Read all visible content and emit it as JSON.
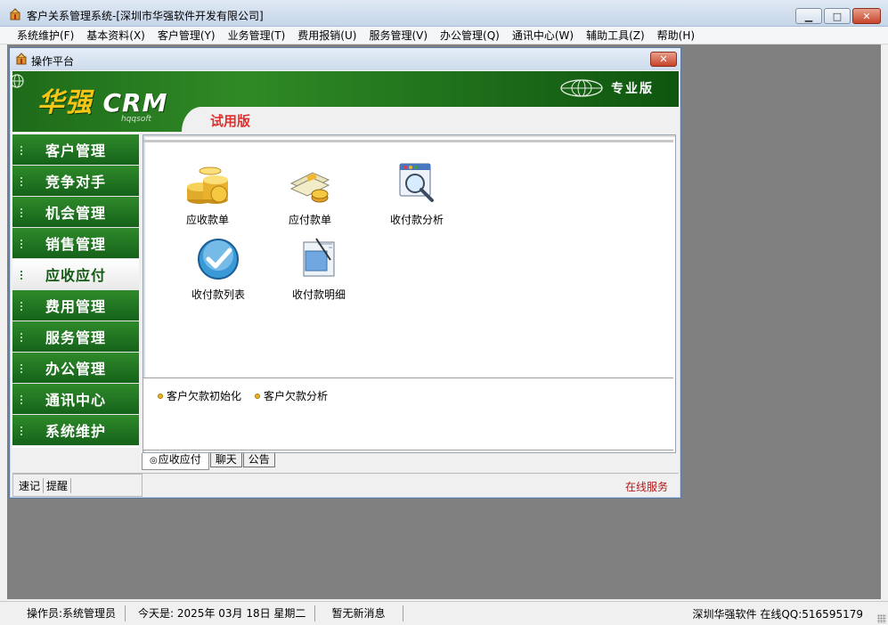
{
  "window": {
    "title": "客户关系管理系统-[深圳市华强软件开发有限公司]",
    "minimize_symbol": "▁",
    "maximize_symbol": "□",
    "close_symbol": "✕"
  },
  "menubar": {
    "items": [
      "系统维护(F)",
      "基本资料(X)",
      "客户管理(Y)",
      "业务管理(T)",
      "费用报销(U)",
      "服务管理(V)",
      "办公管理(Q)",
      "通讯中心(W)",
      "辅助工具(Z)",
      "帮助(H)"
    ]
  },
  "child_window": {
    "title": "操作平台",
    "close_symbol": "✕"
  },
  "banner": {
    "logo_cn": "华强",
    "logo_en": "CRM",
    "logo_sub": "hqqsoft",
    "edition": "专业版",
    "trial": "试用版"
  },
  "nav": {
    "items": [
      {
        "label": "客户管理",
        "active": false
      },
      {
        "label": "竞争对手",
        "active": false
      },
      {
        "label": "机会管理",
        "active": false
      },
      {
        "label": "销售管理",
        "active": false
      },
      {
        "label": "应收应付",
        "active": true
      },
      {
        "label": "费用管理",
        "active": false
      },
      {
        "label": "服务管理",
        "active": false
      },
      {
        "label": "办公管理",
        "active": false
      },
      {
        "label": "通讯中心",
        "active": false
      },
      {
        "label": "系统维护",
        "active": false
      }
    ]
  },
  "tiles": [
    {
      "label": "应收款单",
      "icon": "coins-icon"
    },
    {
      "label": "应付款单",
      "icon": "cash-coins-icon"
    },
    {
      "label": "收付款分析",
      "icon": "magnifier-window-icon"
    },
    {
      "label": "收付款列表",
      "icon": "checkmark-circle-icon"
    },
    {
      "label": "收付款明细",
      "icon": "document-pen-icon"
    }
  ],
  "links": [
    {
      "label": "客户欠款初始化"
    },
    {
      "label": "客户欠款分析"
    }
  ],
  "tabs": {
    "items": [
      "应收应付",
      "聊天",
      "公告"
    ],
    "active_index": 0
  },
  "child_status": {
    "quick_items": [
      "速记",
      "提醒"
    ],
    "online": "在线服务"
  },
  "statusbar": {
    "operator": "操作员:系统管理员",
    "date": "今天是: 2025年 03月 18日  星期二",
    "message": "暂无新消息",
    "company": "深圳华强软件 在线QQ:516595179"
  },
  "colors": {
    "nav_green": "#1f7220",
    "trial_red": "#e03030",
    "logo_gold": "#f5c518",
    "online_red": "#b01818"
  }
}
